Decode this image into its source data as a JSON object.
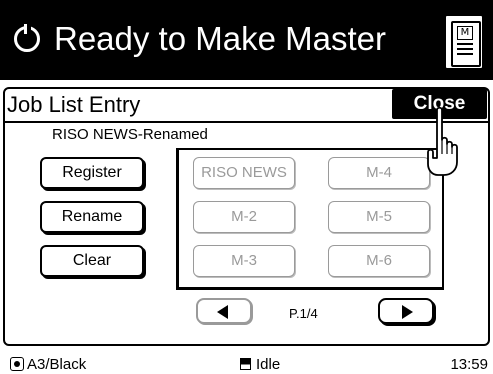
{
  "header": {
    "title": "Ready to Make Master",
    "status_icon": "circular-progress-icon",
    "menu_icon": "master-menu-icon",
    "menu_icon_letter": "M"
  },
  "panel": {
    "title": "Job List Entry",
    "close_label": "Close",
    "selected_job": "RISO NEWS-Renamed"
  },
  "actions": {
    "register_label": "Register",
    "rename_label": "Rename",
    "clear_label": "Clear"
  },
  "jobs": [
    "RISO NEWS",
    "M-2",
    "M-3",
    "M-4",
    "M-5",
    "M-6"
  ],
  "pager": {
    "page_text": "P.1/4",
    "prev_icon": "left-triangle-icon",
    "next_icon": "right-triangle-icon"
  },
  "status": {
    "paper": "A3/Black",
    "state": "Idle",
    "clock": "13:59"
  },
  "colors": {
    "header_bg": "#000000",
    "disabled_text": "#9a9a9a"
  }
}
